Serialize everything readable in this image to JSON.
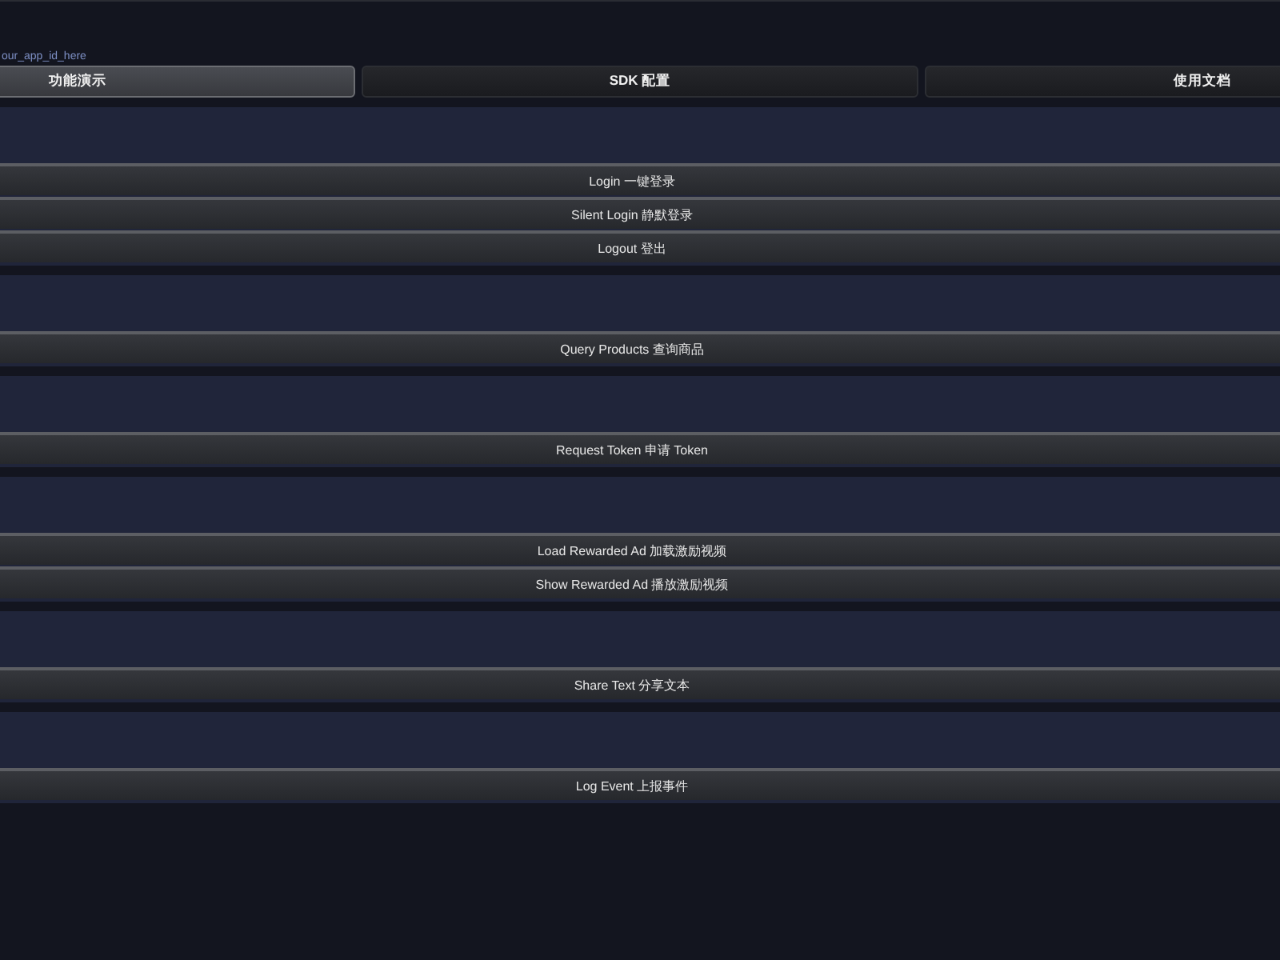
{
  "app_id": "our_app_id_here",
  "tabs": [
    {
      "label": "功能演示",
      "selected": true
    },
    {
      "label": "SDK 配置",
      "selected": false
    },
    {
      "label": "使用文档",
      "selected": false
    }
  ],
  "sections": [
    {
      "buttons": [
        "Login 一键登录",
        "Silent Login 静默登录",
        "Logout 登出"
      ]
    },
    {
      "buttons": [
        "Query Products 查询商品"
      ]
    },
    {
      "buttons": [
        "Request Token 申请 Token"
      ]
    },
    {
      "buttons": [
        "Load Rewarded Ad 加载激励视频",
        "Show Rewarded Ad 播放激励视频"
      ]
    },
    {
      "buttons": [
        "Share Text 分享文本"
      ]
    },
    {
      "buttons": [
        "Log Event 上报事件"
      ]
    }
  ]
}
